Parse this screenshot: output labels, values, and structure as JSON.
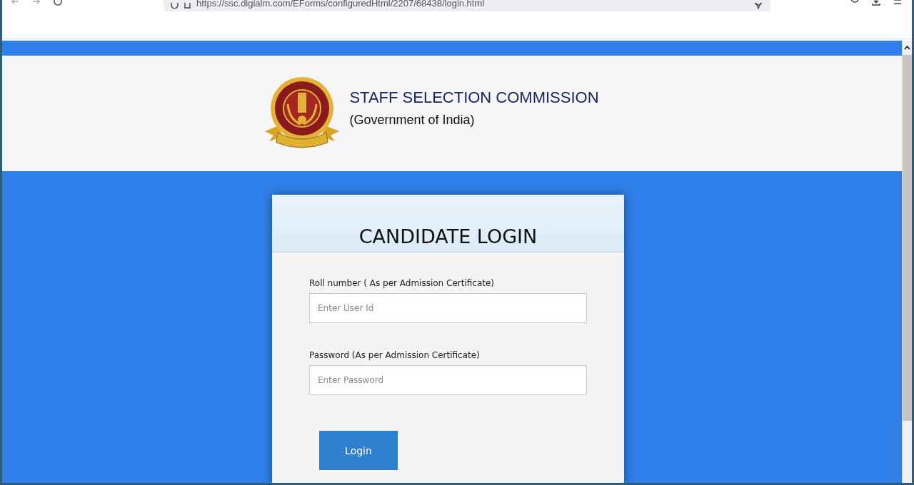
{
  "browser": {
    "url": "https://ssc.digialm.com/EForms/configuredHtml/2207/68438/login.html"
  },
  "header": {
    "title": "STAFF SELECTION COMMISSION",
    "subtitle": "(Government of India)"
  },
  "login": {
    "title": "CANDIDATE LOGIN",
    "fields": [
      {
        "label": "Roll number ( As per Admission Certificate)",
        "placeholder": "Enter User Id"
      },
      {
        "label": "Password (As per Admission Certificate)",
        "placeholder": "Enter Password"
      }
    ],
    "button": "Login"
  }
}
